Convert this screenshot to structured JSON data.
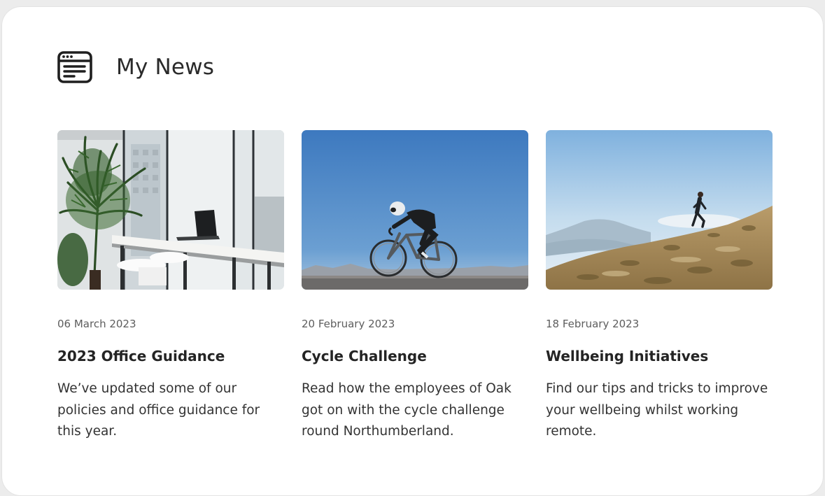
{
  "widget": {
    "title": "My News",
    "icon": "news-icon"
  },
  "articles": [
    {
      "date": "06 March 2023",
      "title": "2023 Office Guidance",
      "summary": "We’ve updated some of our policies and office guidance for this year.",
      "image": "office-interior-image"
    },
    {
      "date": "20 February 2023",
      "title": "Cycle Challenge",
      "summary": "Read how the employees of Oak got on with the cycle challenge round Northumberland.",
      "image": "cyclist-image"
    },
    {
      "date": "18 February 2023",
      "title": "Wellbeing Initiatives",
      "summary": "Find our tips and tricks to improve your wellbeing whilst working remote.",
      "image": "hill-runner-image"
    }
  ]
}
